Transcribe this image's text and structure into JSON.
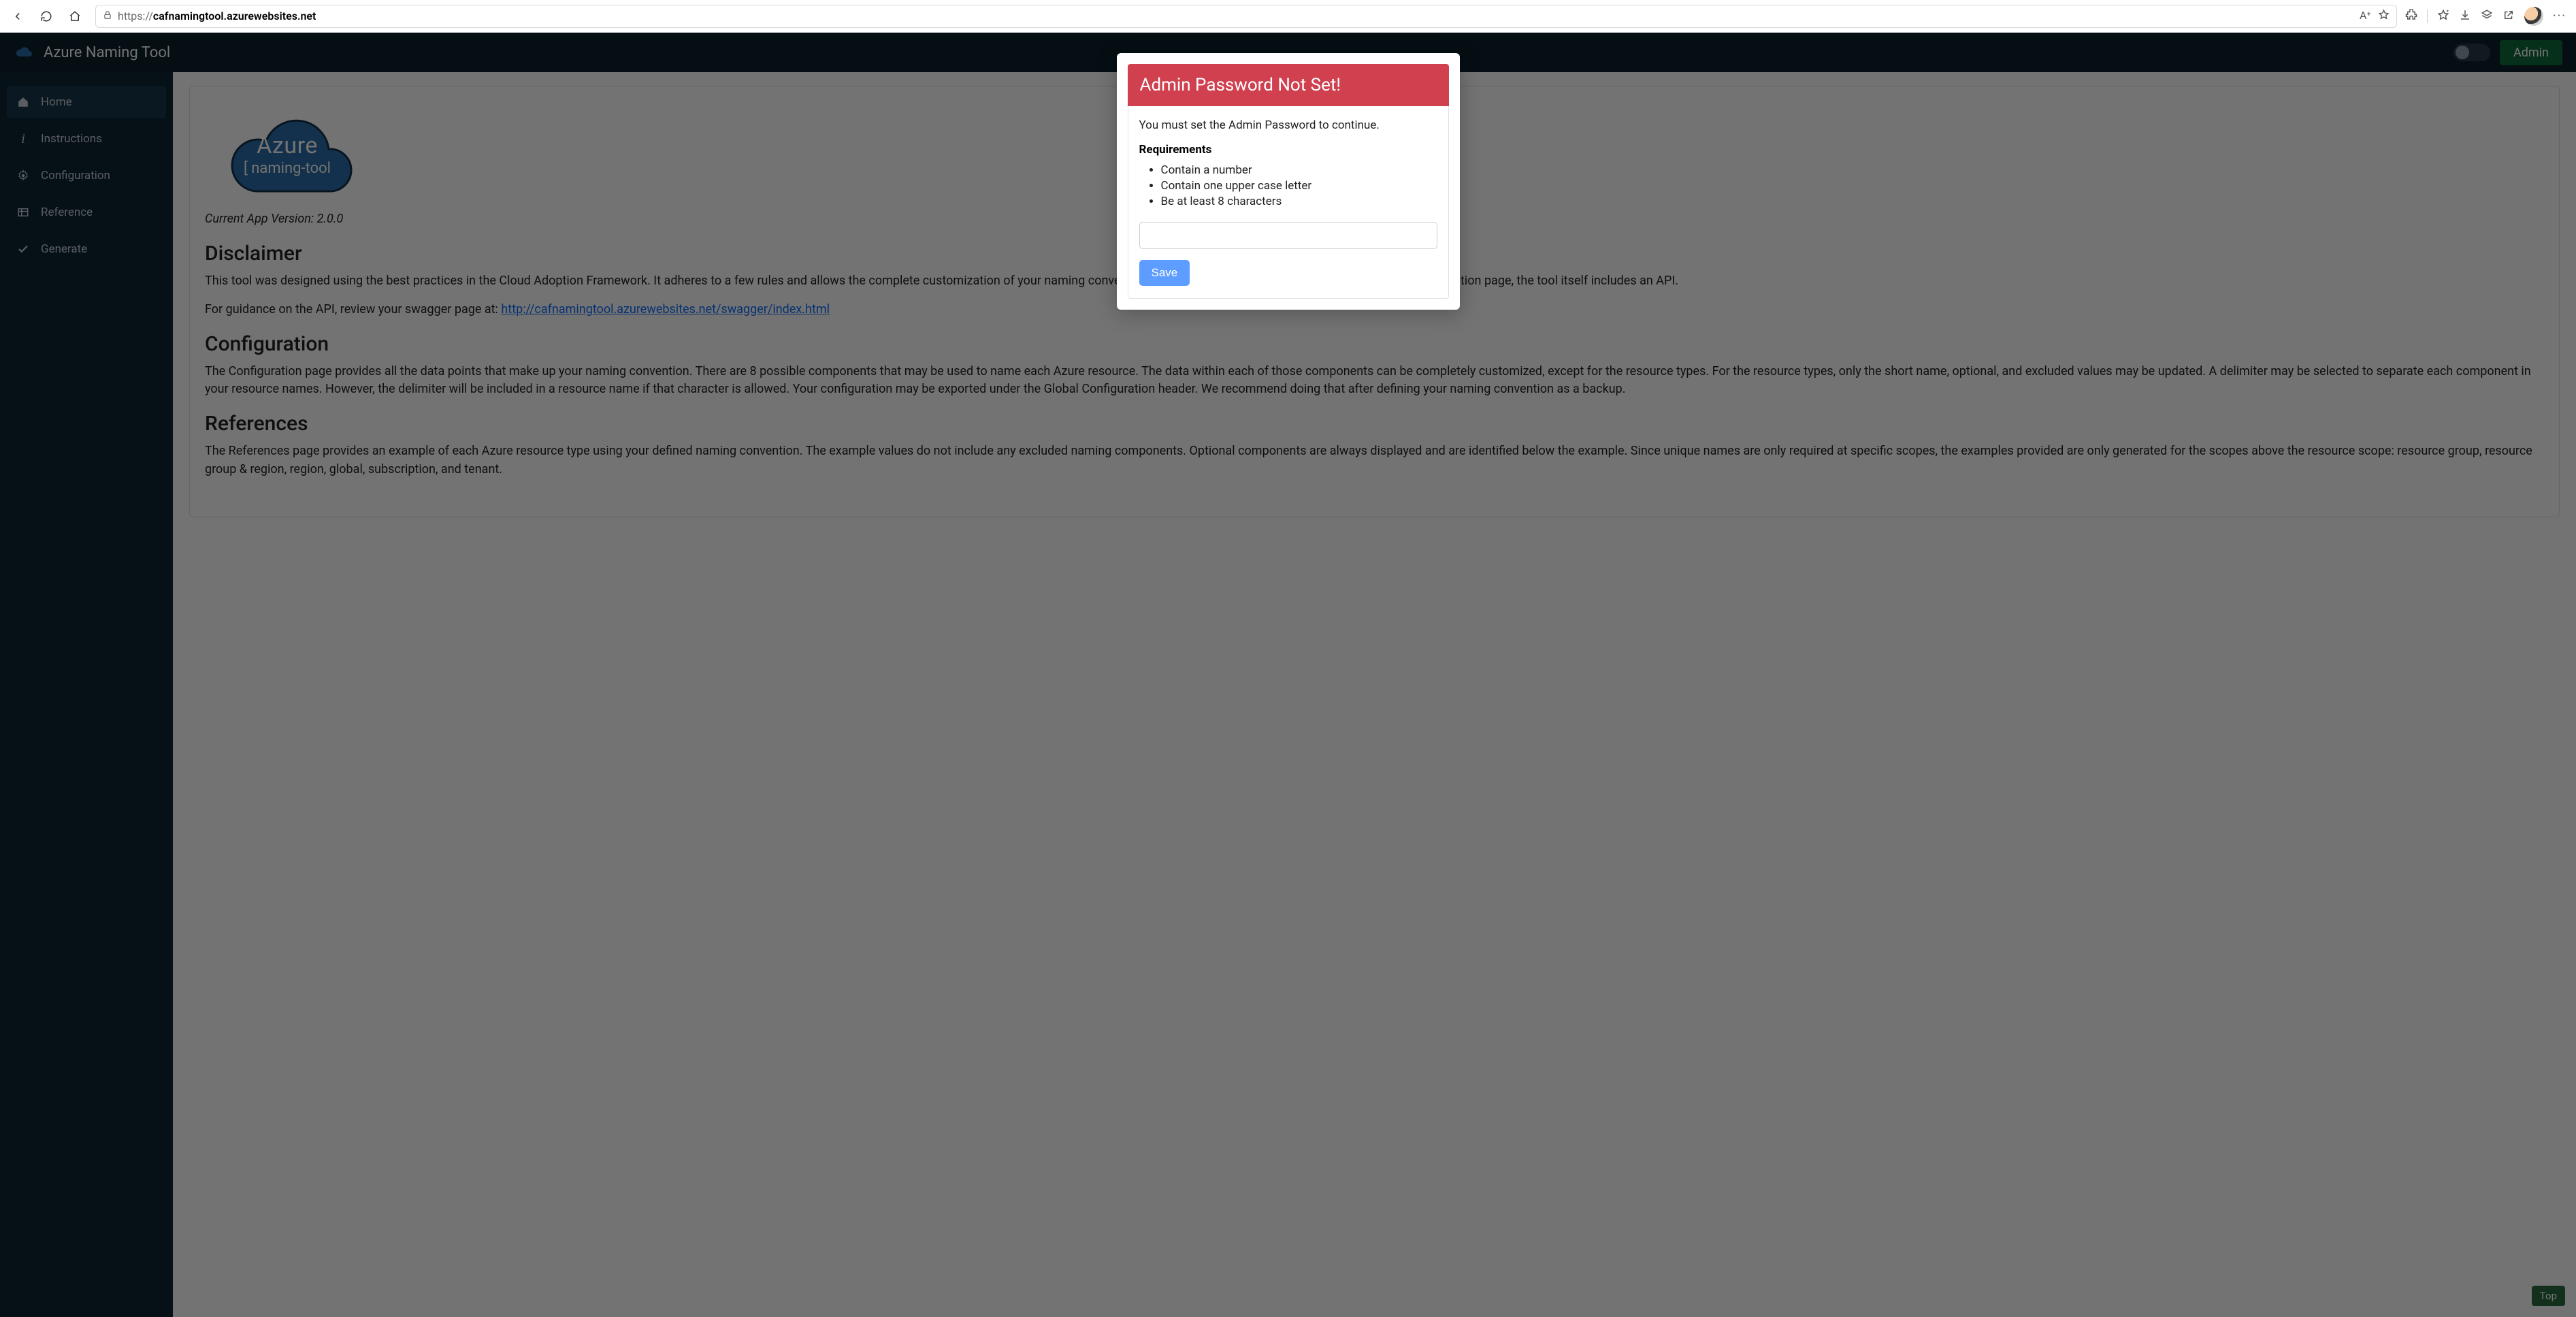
{
  "browser": {
    "url_proto": "https://",
    "url_domain": "cafnamingtool.azurewebsites.net",
    "url_path": ""
  },
  "app": {
    "title": "Azure Naming Tool",
    "admin_label": "Admin"
  },
  "sidebar": {
    "items": [
      {
        "label": "Home"
      },
      {
        "label": "Instructions"
      },
      {
        "label": "Configuration"
      },
      {
        "label": "Reference"
      },
      {
        "label": "Generate"
      }
    ]
  },
  "logo": {
    "line1": "Azure",
    "line2": "[ naming-tool"
  },
  "content": {
    "version_prefix": "Current App Version: ",
    "version": "2.0.0",
    "h_disclaimer": "Disclaimer",
    "disclaimer_p1": "This tool was designed using the best practices in the Cloud Adoption Framework. It adheres to a few rules and allows the complete customization of your naming convention. While most of the customization is done in the configuration page, the tool itself includes an API.",
    "disclaimer_p2_pre": "For guidance on the API, review your swagger page at: ",
    "swagger_url": "http://cafnamingtool.azurewebsites.net/swagger/index.html",
    "h_config": "Configuration",
    "config_p": "The Configuration page provides all the data points that make up your naming convention. There are 8 possible components that may be used to name each Azure resource. The data within each of those components can be completely customized, except for the resource types. For the resource types, only the short name, optional, and excluded values may be updated. A delimiter may be selected to separate each component in your resource names. However, the delimiter will be included in a resource name if that character is allowed. Your configuration may be exported under the Global Configuration header. We recommend doing that after defining your naming convention as a backup.",
    "h_refs": "References",
    "refs_p": "The References page provides an example of each Azure resource type using your defined naming convention. The example values do not include any excluded naming components. Optional components are always displayed and are identified below the example. Since unique names are only required at specific scopes, the examples provided are only generated for the scopes above the resource scope: resource group, resource group & region, region, global, subscription, and tenant."
  },
  "top_btn": "Top",
  "modal": {
    "title": "Admin Password Not Set!",
    "msg": "You must set the Admin Password to continue.",
    "req_heading": "Requirements",
    "reqs": [
      "Contain a number",
      "Contain one upper case letter",
      "Be at least 8 characters"
    ],
    "save": "Save"
  }
}
